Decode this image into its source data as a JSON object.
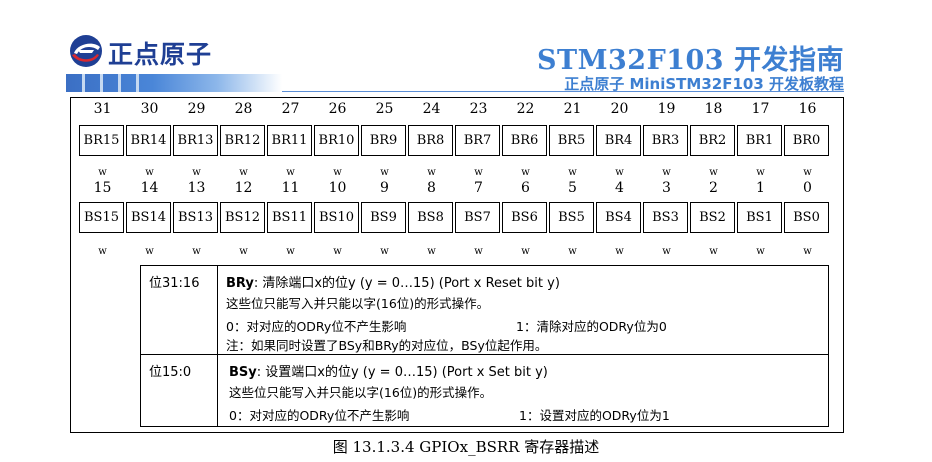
{
  "header": {
    "logo_text": "正点原子",
    "title": "STM32F103 开发指南",
    "subtitle": "正点原子 MiniSTM32F103 开发板教程"
  },
  "register": {
    "upper": {
      "bits": [
        "31",
        "30",
        "29",
        "28",
        "27",
        "26",
        "25",
        "24",
        "23",
        "22",
        "21",
        "20",
        "19",
        "18",
        "17",
        "16"
      ],
      "fields": [
        "BR15",
        "BR14",
        "BR13",
        "BR12",
        "BR11",
        "BR10",
        "BR9",
        "BR8",
        "BR7",
        "BR6",
        "BR5",
        "BR4",
        "BR3",
        "BR2",
        "BR1",
        "BR0"
      ],
      "access": [
        "w",
        "w",
        "w",
        "w",
        "w",
        "w",
        "w",
        "w",
        "w",
        "w",
        "w",
        "w",
        "w",
        "w",
        "w",
        "w"
      ]
    },
    "lower": {
      "bits": [
        "15",
        "14",
        "13",
        "12",
        "11",
        "10",
        "9",
        "8",
        "7",
        "6",
        "5",
        "4",
        "3",
        "2",
        "1",
        "0"
      ],
      "fields": [
        "BS15",
        "BS14",
        "BS13",
        "BS12",
        "BS11",
        "BS10",
        "BS9",
        "BS8",
        "BS7",
        "BS6",
        "BS5",
        "BS4",
        "BS3",
        "BS2",
        "BS1",
        "BS0"
      ],
      "access": [
        "w",
        "w",
        "w",
        "w",
        "w",
        "w",
        "w",
        "w",
        "w",
        "w",
        "w",
        "w",
        "w",
        "w",
        "w",
        "w"
      ]
    }
  },
  "description": {
    "br": {
      "bits": "位31:16",
      "name": "BRy",
      "line1_rest": ": 清除端口x的位y (y = 0…15) (Port x Reset bit y)",
      "line2": "这些位只能写入并只能以字(16位)的形式操作。",
      "line3_a": "0：对对应的ODRy位不产生影响",
      "line3_b": "1：清除对应的ODRy位为0",
      "line4": "注：如果同时设置了BSy和BRy的对应位，BSy位起作用。"
    },
    "bs": {
      "bits": "位15:0",
      "name": "BSy",
      "line1_rest": ": 设置端口x的位y (y = 0…15) (Port x Set bit y)",
      "line2": "这些位只能写入并只能以字(16位)的形式操作。",
      "line3_a": "0：对对应的ODRy位不产生影响",
      "line3_b": "1：设置对应的ODRy位为1"
    }
  },
  "caption": "图 13.1.3.4 GPIOx_BSRR 寄存器描述",
  "colors": {
    "brand_blue": "#3d7fd1",
    "logo_navy": "#1f3f94",
    "logo_red": "#d9282f"
  },
  "icons": {
    "logo": "alientek-logo-icon"
  }
}
